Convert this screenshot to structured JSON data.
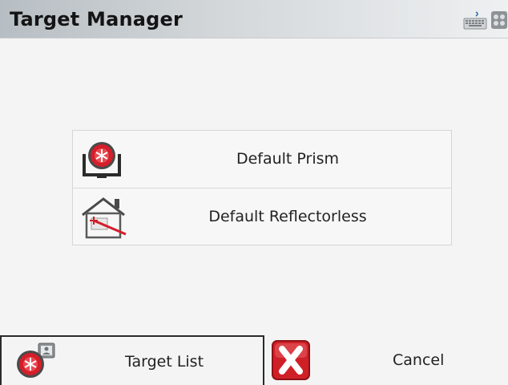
{
  "window": {
    "title": "Target Manager"
  },
  "titlebar_icons": [
    "keyboard-icon",
    "settings-icon"
  ],
  "targets": [
    {
      "label": "Default Prism",
      "icon": "prism-icon"
    },
    {
      "label": "Default Reflectorless",
      "icon": "reflectorless-icon"
    }
  ],
  "bottom_bar": {
    "target_list_label": "Target List",
    "cancel_label": "Cancel"
  },
  "colors": {
    "prism_red": "#d41e2a",
    "cancel_red": "#cf2027"
  }
}
